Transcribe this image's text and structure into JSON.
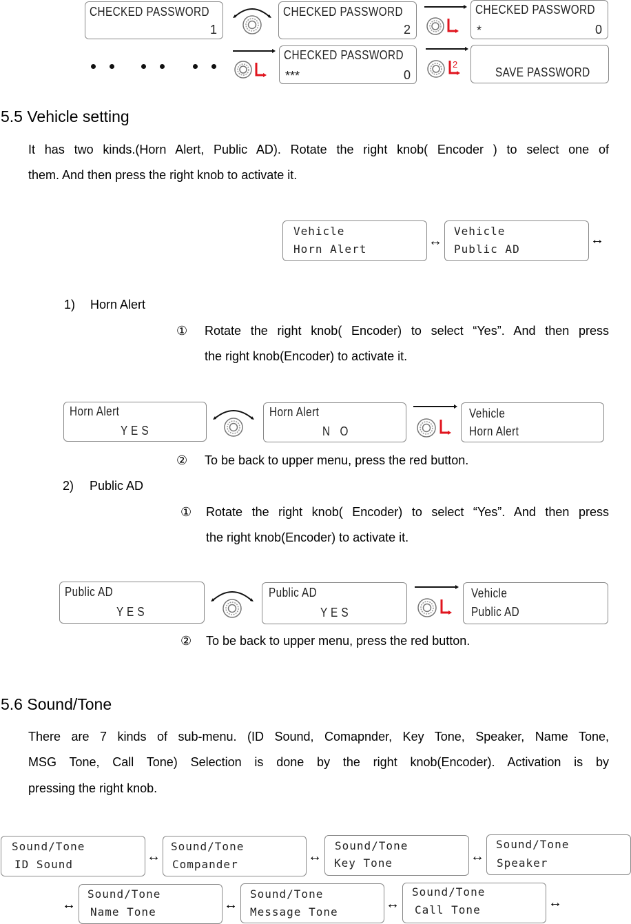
{
  "password_flow": {
    "screens": [
      {
        "line1": "CHECKED PASSWORD",
        "line2_left": "",
        "line2_right": "1"
      },
      {
        "line1": "CHECKED PASSWORD",
        "line2_left": "",
        "line2_right": "2"
      },
      {
        "line1": "CHECKED PASSWORD",
        "line2_left": "*",
        "line2_right": "0"
      },
      {
        "line1": "CHECKED PASSWORD",
        "line2_left": "***",
        "line2_right": "0"
      },
      {
        "line1": "",
        "line2_left": "SAVE PASSWORD",
        "line2_right": ""
      }
    ],
    "ellipsis_icon": "dots-ellipsis",
    "press_label": "L",
    "long_press_label": "L2"
  },
  "section_5_5": {
    "heading": "5.5 Vehicle setting",
    "intro_line1": "It has two kinds.(Horn Alert, Public AD). Rotate the right knob( Encoder ) to select one of",
    "intro_line2": "them. And then press the right knob to activate it.",
    "menu_screens": [
      {
        "line1": "Vehicle",
        "line2": "Horn Alert"
      },
      {
        "line1": "Vehicle",
        "line2": "Public AD"
      }
    ],
    "cycle_icon": "↔",
    "items": [
      {
        "number": "1)",
        "title": "Horn Alert",
        "step1_marker": "①",
        "step1_line1": "Rotate the right knob( Encoder) to select “Yes”. And then press",
        "step1_line2": "the right knob(Encoder) to activate it.",
        "screens": [
          {
            "line1": "Horn Alert",
            "line2": "Y E S"
          },
          {
            "line1": "Horn Alert",
            "line2": "N   O"
          },
          {
            "line1": "Vehicle",
            "line2": "Horn Alert"
          }
        ],
        "step2_marker": "②",
        "step2_text": "To be back to upper menu, press the red button."
      },
      {
        "number": "2)",
        "title": "Public AD",
        "step1_marker": "①",
        "step1_line1": "Rotate the right knob( Encoder) to select “Yes”. And then press",
        "step1_line2": "the right knob(Encoder) to activate it.",
        "screens": [
          {
            "line1": "Public AD",
            "line2": "Y E S"
          },
          {
            "line1": "Public AD",
            "line2": "Y E S"
          },
          {
            "line1": "Vehicle",
            "line2": "Public AD"
          }
        ],
        "step2_marker": "②",
        "step2_text": "To be back to upper menu, press the red button."
      }
    ]
  },
  "section_5_6": {
    "heading": "5.6 Sound/Tone",
    "intro_line1": "There are 7 kinds of sub-menu. (ID Sound, Comapnder, Key Tone, Speaker, Name Tone,",
    "intro_line2": "MSG Tone, Call Tone) Selection is done by the right knob(Encoder). Activation is by",
    "intro_line3": "pressing the right knob.",
    "menu_screens": [
      {
        "line1": "Sound/Tone",
        "line2": "ID Sound"
      },
      {
        "line1": "Sound/Tone",
        "line2": "Compander"
      },
      {
        "line1": "Sound/Tone",
        "line2": "Key Tone"
      },
      {
        "line1": "Sound/Tone",
        "line2": "Speaker"
      },
      {
        "line1": "Sound/Tone",
        "line2": "Name Tone"
      },
      {
        "line1": "Sound/Tone",
        "line2": "Message Tone"
      },
      {
        "line1": "Sound/Tone",
        "line2": "Call Tone"
      }
    ],
    "cycle_icon": "↔"
  },
  "colors": {
    "press_red": "#e0141e",
    "lcd_border": "#888888"
  }
}
